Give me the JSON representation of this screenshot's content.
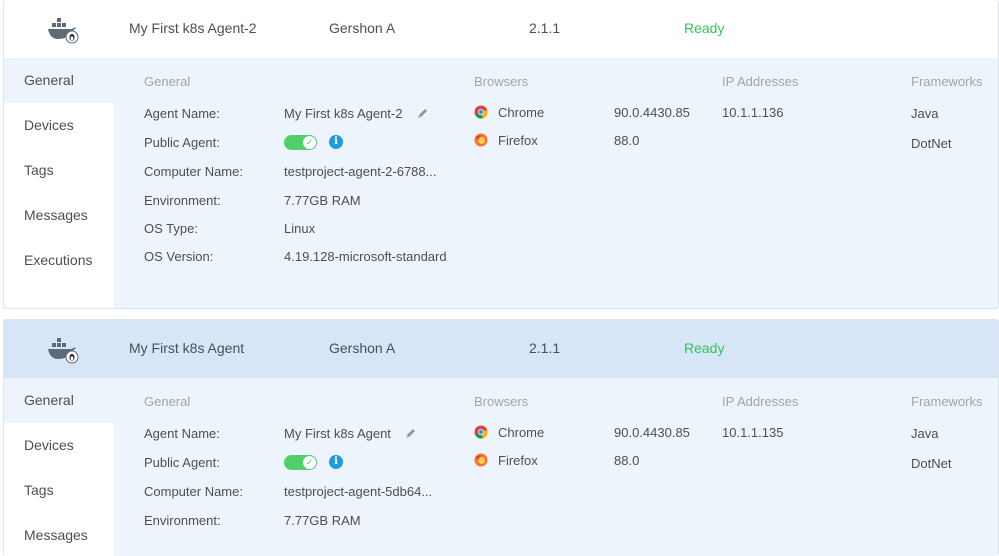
{
  "colors": {
    "ready": "#35c45a",
    "toggle_on": "#4fd06b",
    "info": "#1e9be3",
    "selected_row": "#d6e6f6",
    "detail_bg": "#eef4fb"
  },
  "agents": [
    {
      "name": "My First k8s Agent-2",
      "owner": "Gershon A",
      "version": "2.1.1",
      "status": "Ready",
      "tabs": [
        "General",
        "Devices",
        "Tags",
        "Messages",
        "Executions"
      ],
      "general": {
        "title": "General",
        "agent_name_label": "Agent Name:",
        "agent_name": "My First k8s Agent-2",
        "public_label": "Public Agent:",
        "computer_label": "Computer Name:",
        "computer_name": "testproject-agent-2-6788...",
        "env_label": "Environment:",
        "environment": "7.77GB RAM",
        "os_type_label": "OS Type:",
        "os_type": "Linux",
        "os_version_label": "OS Version:",
        "os_version": "4.19.128-microsoft-standard"
      },
      "browsers_title": "Browsers",
      "browsers": [
        {
          "icon": "chrome-icon",
          "name": "Chrome",
          "version": "90.0.4430.85"
        },
        {
          "icon": "firefox-icon",
          "name": "Firefox",
          "version": "88.0"
        }
      ],
      "ip_title": "IP Addresses",
      "ip": "10.1.1.136",
      "frameworks_title": "Frameworks",
      "frameworks": [
        "Java",
        "DotNet"
      ]
    },
    {
      "name": "My First k8s Agent",
      "owner": "Gershon A",
      "version": "2.1.1",
      "status": "Ready",
      "tabs": [
        "General",
        "Devices",
        "Tags",
        "Messages"
      ],
      "general": {
        "title": "General",
        "agent_name_label": "Agent Name:",
        "agent_name": "My First k8s Agent",
        "public_label": "Public Agent:",
        "computer_label": "Computer Name:",
        "computer_name": "testproject-agent-5db64...",
        "env_label": "Environment:",
        "environment": "7.77GB RAM"
      },
      "browsers_title": "Browsers",
      "browsers": [
        {
          "icon": "chrome-icon",
          "name": "Chrome",
          "version": "90.0.4430.85"
        },
        {
          "icon": "firefox-icon",
          "name": "Firefox",
          "version": "88.0"
        }
      ],
      "ip_title": "IP Addresses",
      "ip": "10.1.1.135",
      "frameworks_title": "Frameworks",
      "frameworks": [
        "Java",
        "DotNet"
      ]
    }
  ]
}
